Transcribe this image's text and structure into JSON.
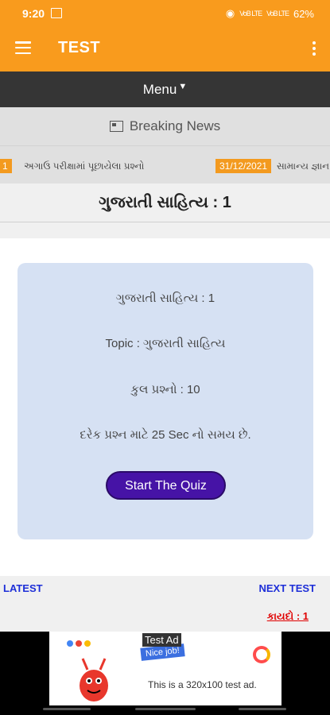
{
  "status": {
    "time": "9:20",
    "battery": "62%",
    "net1": "VoB LTE",
    "net2": "VoB LTE"
  },
  "appbar": {
    "title": "TEST"
  },
  "menu": {
    "label": "Menu"
  },
  "breaking": {
    "label": "Breaking News"
  },
  "ticker": {
    "left_badge": "1",
    "headline": "અગાઉ પરીક્ષામાં પૂછાયેલા પ્રશ્નો",
    "date_badge": "31/12/2021",
    "right_text": "સામાન્ય જ્ઞાન"
  },
  "page": {
    "title": "ગુજરાતી સાહિત્ય : 1"
  },
  "quiz": {
    "name": "ગુજરાતી સાહિત્ય : 1",
    "topic": "Topic : ગુજરાતી સાહિત્ય",
    "total": "કુલ પ્રશ્નો : 10",
    "time": "દરેક પ્રશ્ન માટે 25 Sec નો સમય છે.",
    "start_label": "Start The Quiz"
  },
  "nav": {
    "latest": "LATEST",
    "next": "NEXT TEST",
    "kaydo": "કાયદો : 1"
  },
  "ad": {
    "label": "Test Ad",
    "badge": "Nice job!",
    "text": "This is a 320x100 test ad."
  },
  "colors": {
    "accent": "#f99b1d",
    "menu": "#353535",
    "button": "#4613a6",
    "link": "#1e2fd8"
  }
}
